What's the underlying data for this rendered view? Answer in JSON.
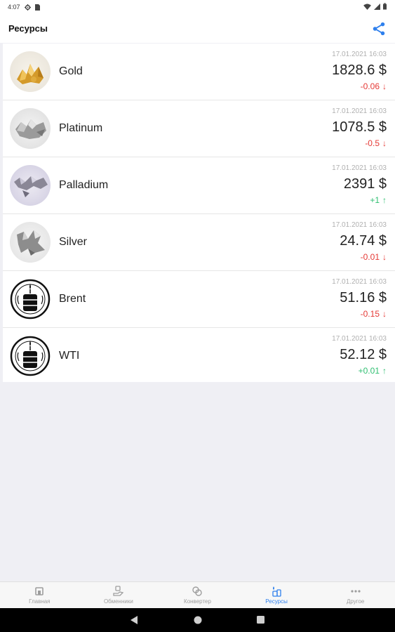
{
  "status_bar": {
    "time": "4:07",
    "left_icons": [
      "settings-gear",
      "sim-card"
    ],
    "right_icons": [
      "wifi",
      "signal",
      "battery"
    ]
  },
  "header": {
    "title": "Ресурсы",
    "share_icon": "share-icon",
    "accent_color": "#2f80ed"
  },
  "resources": [
    {
      "name": "Gold",
      "date": "17.01.2021 16:03",
      "price": "1828.6 $",
      "change": "-0.06",
      "direction": "down",
      "icon": "gold-nuggets-image"
    },
    {
      "name": "Platinum",
      "date": "17.01.2021 16:03",
      "price": "1078.5 $",
      "change": "-0.5",
      "direction": "down",
      "icon": "platinum-nuggets-image"
    },
    {
      "name": "Palladium",
      "date": "17.01.2021 16:03",
      "price": "2391 $",
      "change": "+1",
      "direction": "up",
      "icon": "palladium-crystal-image"
    },
    {
      "name": "Silver",
      "date": "17.01.2021 16:03",
      "price": "24.74 $",
      "change": "-0.01",
      "direction": "down",
      "icon": "silver-crystal-image"
    },
    {
      "name": "Brent",
      "date": "17.01.2021 16:03",
      "price": "51.16 $",
      "change": "-0.15",
      "direction": "down",
      "icon": "oil-barrel-icon"
    },
    {
      "name": "WTI",
      "date": "17.01.2021 16:03",
      "price": "52.12 $",
      "change": "+0.01",
      "direction": "up",
      "icon": "oil-barrel-icon"
    }
  ],
  "colors": {
    "down": "#e53935",
    "up": "#2fbf71",
    "active_tab": "#2f80ed",
    "inactive_tab": "#9e9e9e"
  },
  "bottom_nav": [
    {
      "label": "Главная",
      "icon": "home-icon",
      "active": false
    },
    {
      "label": "Обменники",
      "icon": "exchange-hand-icon",
      "active": false
    },
    {
      "label": "Конвертер",
      "icon": "converter-icon",
      "active": false
    },
    {
      "label": "Ресурсы",
      "icon": "resources-icon",
      "active": true
    },
    {
      "label": "Другое",
      "icon": "more-dots-icon",
      "active": false
    }
  ],
  "system_nav": [
    "back",
    "home",
    "recents"
  ]
}
